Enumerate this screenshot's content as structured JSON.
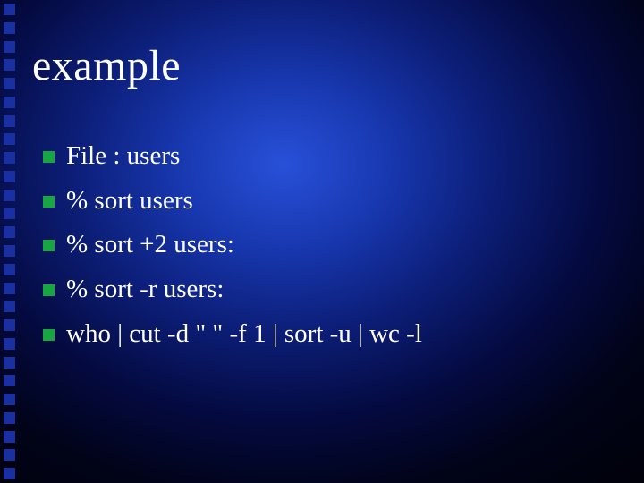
{
  "title": "example",
  "bullets": [
    "File : users",
    "% sort users",
    "% sort +2 users:",
    "% sort -r users:",
    "who | cut -d \" \" -f 1 | sort -u | wc -l"
  ],
  "colors": {
    "bullet": "#17a642",
    "dot": "#1a2fa0"
  }
}
